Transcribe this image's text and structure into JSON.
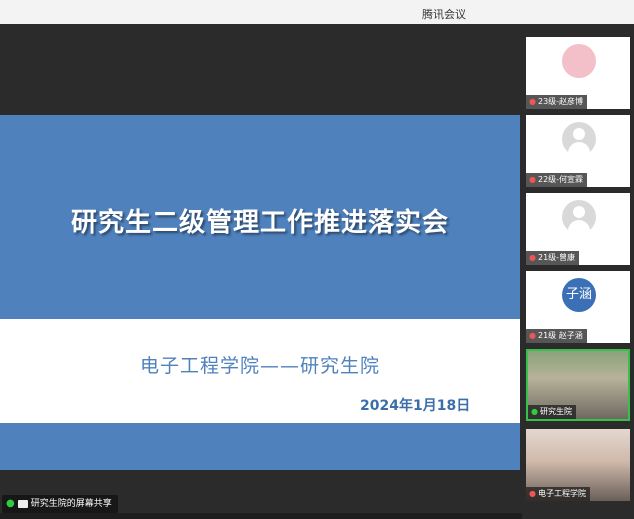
{
  "app": {
    "title": "腾讯会议"
  },
  "slide": {
    "title": "研究生二级管理工作推进落实会",
    "subtitle": "电子工程学院——研究生院",
    "date": "2024年1月18日"
  },
  "share": {
    "label": "研究生院的屏幕共享"
  },
  "participants": [
    {
      "name": "23级-赵彦博"
    },
    {
      "name": "22级-何宣霖"
    },
    {
      "name": "21级-曾康"
    },
    {
      "name": "21级 赵子涵",
      "avatar_text": "子涵"
    },
    {
      "name": "研究生院"
    },
    {
      "name": "电子工程学院"
    }
  ],
  "colors": {
    "accent": "#4f81bd",
    "active_speaker": "#36c24a"
  }
}
